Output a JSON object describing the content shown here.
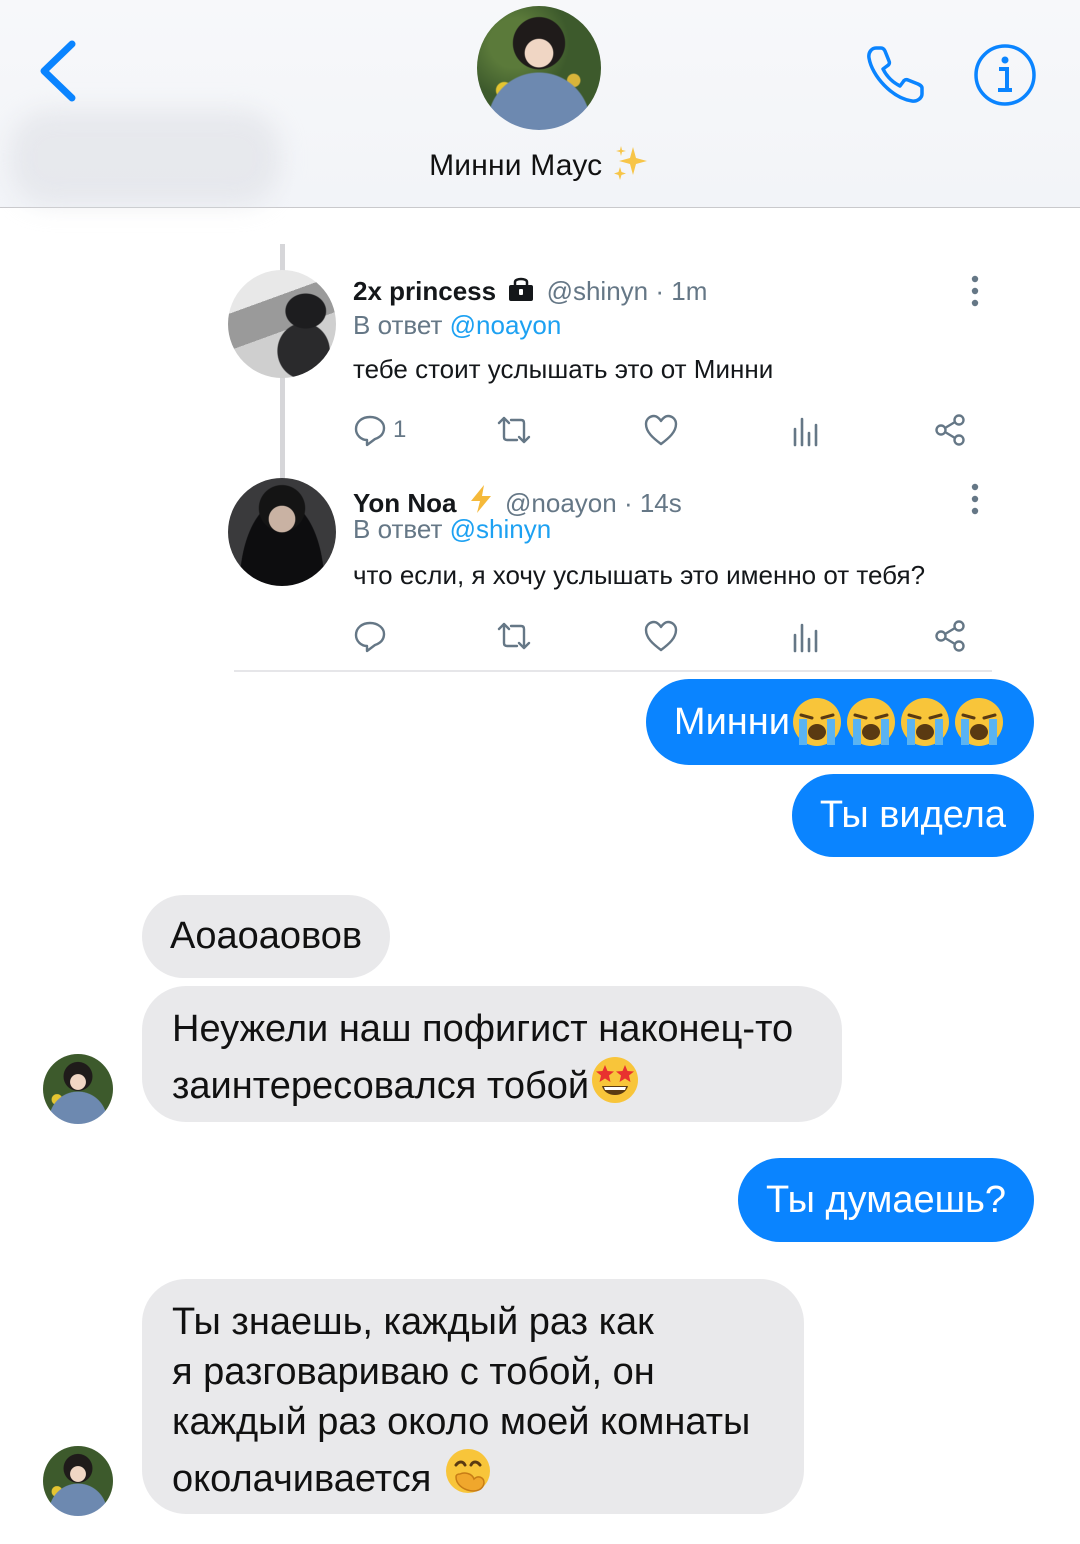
{
  "header": {
    "contact_name": "Минни Маус",
    "name_emoji": "sparkles-icon",
    "back_icon": "chevron-left-icon",
    "call_icon": "phone-icon",
    "info_icon": "info-icon",
    "accent_color": "#0a84ff"
  },
  "tweet_card": {
    "tweets": [
      {
        "display_name": "2x princess",
        "badge_icon": "lock-icon",
        "handle": "@shinyn",
        "time": "· 1m",
        "reply_prefix": "В ответ",
        "reply_to": "@noayon",
        "text": "тебе стоит услышать это от Минни",
        "reply_count": "1"
      },
      {
        "display_name": "Yon Noa",
        "badge_icon": "lightning-icon",
        "handle": "@noayon",
        "time": "· 14s",
        "reply_prefix": "В ответ",
        "reply_to": "@shinyn",
        "text": "что если, я хочу услышать это именно от тебя?",
        "reply_count": ""
      }
    ],
    "action_icons": [
      "reply-icon",
      "retweet-icon",
      "like-icon",
      "analytics-icon",
      "share-icon"
    ],
    "link_color": "#1da1f2"
  },
  "messages": [
    {
      "side": "out",
      "text": "Минни",
      "emoji_count": 4,
      "emoji": "loudly-crying-face"
    },
    {
      "side": "out",
      "text": "Ты видела"
    },
    {
      "side": "in",
      "text": "Аоаоаовов"
    },
    {
      "side": "in",
      "lines": [
        "Неужели наш пофигист наконец-то",
        "заинтересовался тобой"
      ],
      "emoji": "star-struck-face"
    },
    {
      "side": "out",
      "text": "Ты думаешь?"
    },
    {
      "side": "in",
      "lines": [
        "Ты знаешь, каждый раз как",
        "я разговариваю с тобой, он",
        "каждый раз около моей комнаты",
        "околачивается"
      ],
      "emoji": "face-with-hand-over-mouth"
    }
  ]
}
